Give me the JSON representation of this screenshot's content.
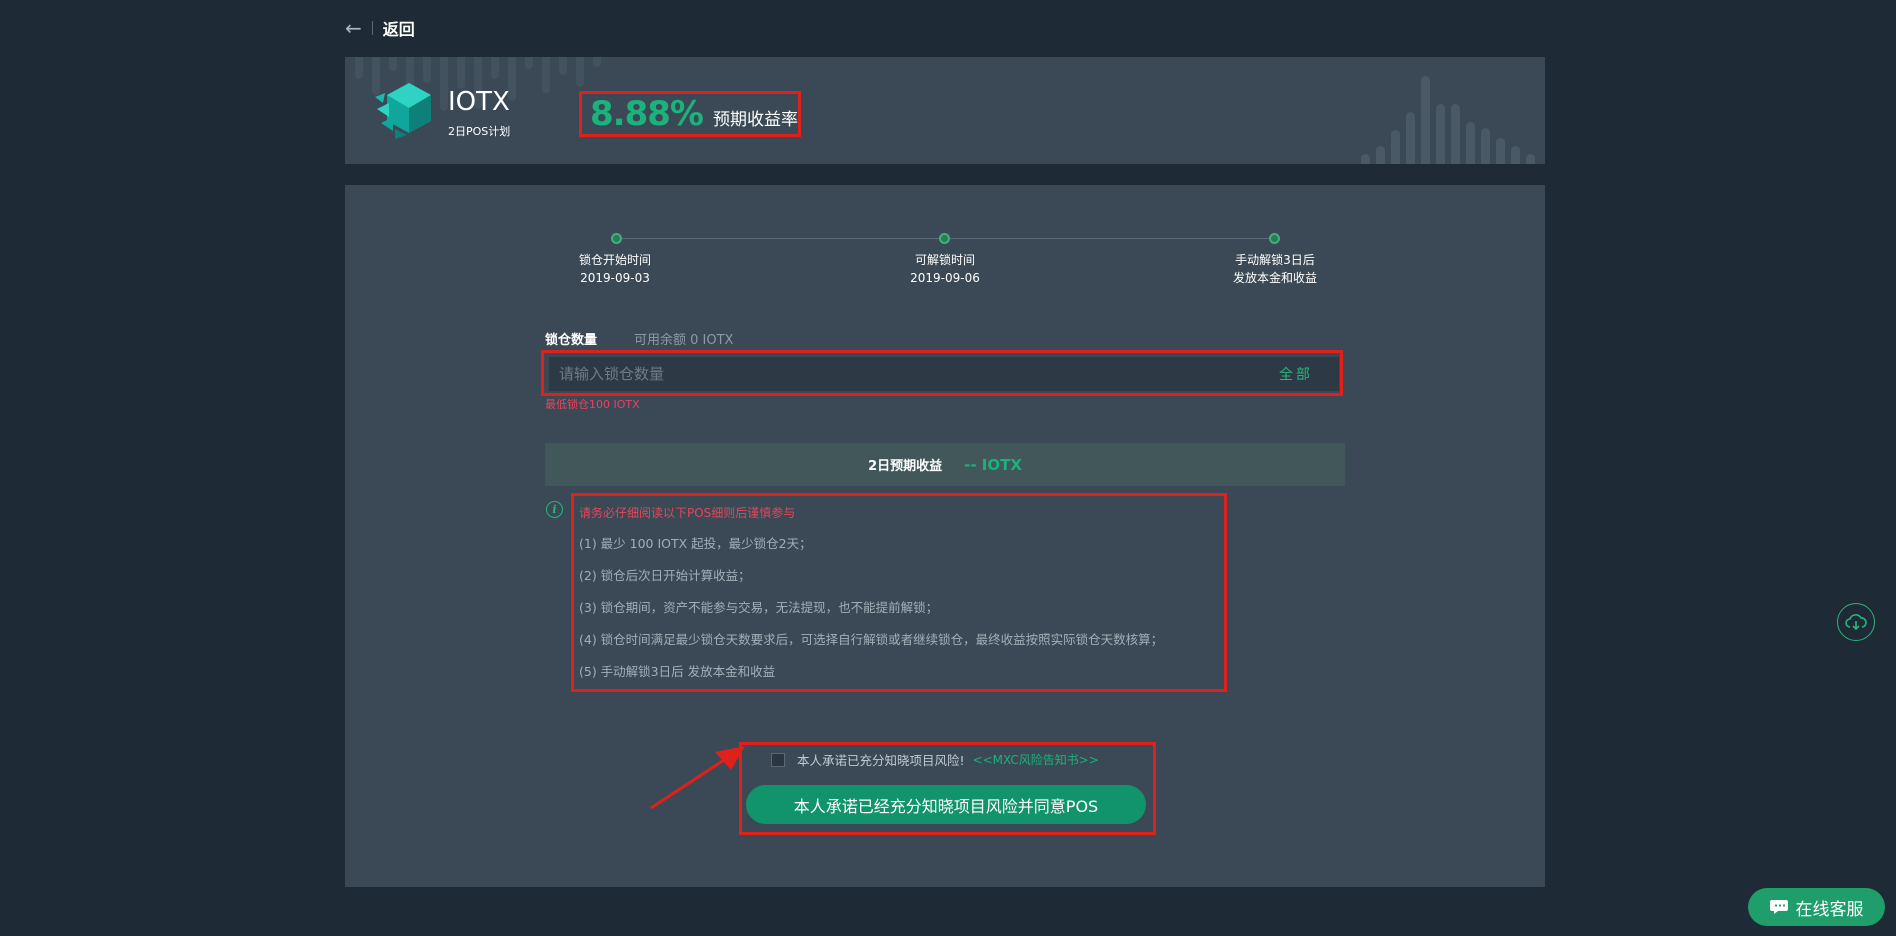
{
  "nav": {
    "back_label": "返回"
  },
  "header": {
    "coin_name": "IOTX",
    "plan_name": "2日POS计划",
    "rate_value": "8.88%",
    "rate_label": "预期收益率"
  },
  "timeline": [
    {
      "label": "锁仓开始时间",
      "value": "2019-09-03"
    },
    {
      "label": "可解锁时间",
      "value": "2019-09-06"
    },
    {
      "label": "手动解锁3日后",
      "value": "发放本金和收益"
    }
  ],
  "lock": {
    "title": "锁仓数量",
    "available": "可用余额 0 IOTX",
    "placeholder": "请输入锁仓数量",
    "all_label": "全部",
    "min_tip": "最低锁仓100 IOTX"
  },
  "profit": {
    "label": "2日预期收益",
    "value": "-- IOTX"
  },
  "rules": {
    "title": "请务必仔细阅读以下POS细则后谨慎参与",
    "items": [
      "(1) 最少 100 IOTX 起投，最少锁仓2天；",
      "(2) 锁仓后次日开始计算收益；",
      "(3) 锁仓期间，资产不能参与交易，无法提现，也不能提前解锁；",
      "(4) 锁仓时间满足最少锁仓天数要求后，可选择自行解锁或者继续锁仓，最终收益按照实际锁仓天数核算；",
      "(5) 手动解锁3日后 发放本金和收益"
    ]
  },
  "agree": {
    "text": "本人承诺已充分知晓项目风险!",
    "link": "<<MXC风险告知书>>",
    "button": "本人承诺已经充分知晓项目风险并同意POS"
  },
  "service": {
    "label": "在线客服"
  },
  "colors": {
    "accent": "#1bb27b",
    "highlight_red": "#e0201b",
    "panel": "#3a4955",
    "bg": "#1e2a35"
  }
}
